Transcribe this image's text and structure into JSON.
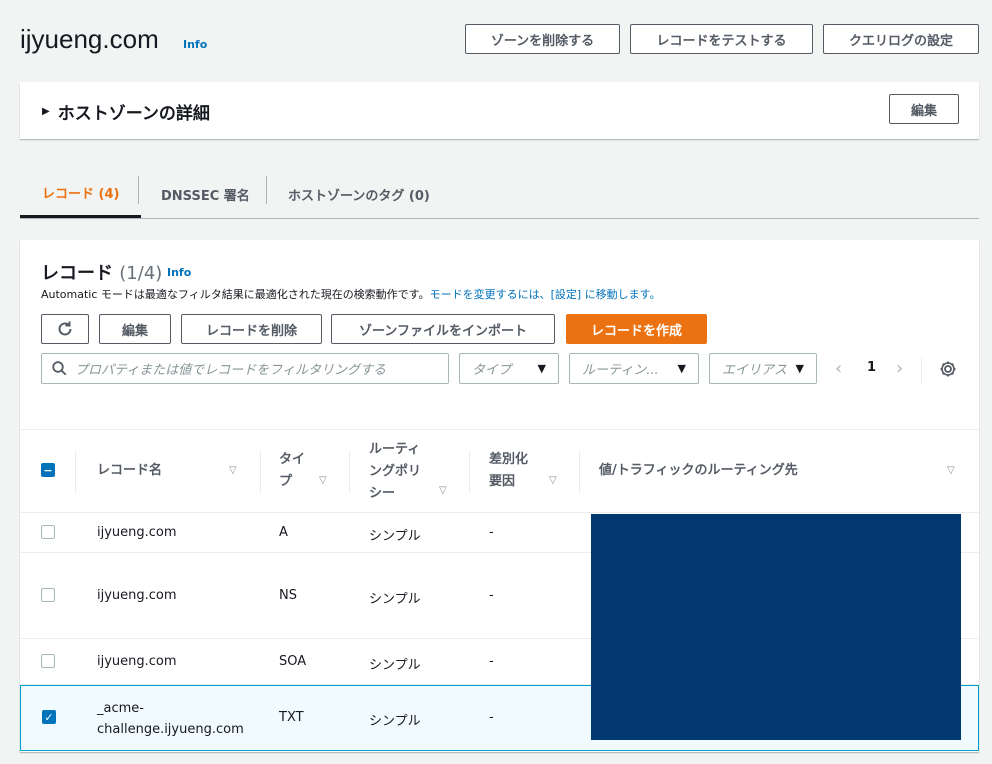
{
  "header": {
    "title": "ijyueng.com",
    "info": "Info",
    "buttons": {
      "delete_zone": "ゾーンを削除する",
      "test_record": "レコードをテストする",
      "query_log": "クエリログの設定"
    }
  },
  "details": {
    "title": "ホストゾーンの詳細",
    "edit": "編集"
  },
  "tabs": [
    {
      "label": "レコード (4)",
      "active": true
    },
    {
      "label": "DNSSEC 署名",
      "active": false
    },
    {
      "label": "ホストゾーンのタグ (0)",
      "active": false
    }
  ],
  "records": {
    "title": "レコード",
    "count": "(1/4)",
    "info": "Info",
    "desc_prefix": "Automatic モードは最適なフィルタ結果に最適化された現在の検索動作です。",
    "desc_link": "モードを変更するには、[設定] に移動します。",
    "actions": {
      "edit": "編集",
      "delete": "レコードを削除",
      "import": "ゾーンファイルをインポート",
      "create": "レコードを作成"
    },
    "search_placeholder": "プロパティまたは値でレコードをフィルタリングする",
    "filters": {
      "type": "タイプ",
      "routing": "ルーティン...",
      "alias": "エイリアス"
    },
    "page": "1",
    "columns": {
      "name": "レコード名",
      "type_l1": "タイ",
      "type_l2": "プ",
      "routing_l1": "ルーティ",
      "routing_l2": "ングポリ",
      "routing_l3": "シー",
      "diff_l1": "差別化",
      "diff_l2": "要因",
      "value": "値/トラフィックのルーティング先"
    },
    "rows": [
      {
        "name": "ijyueng.com",
        "type": "A",
        "policy": "シンプル",
        "diff": "-",
        "checked": false
      },
      {
        "name": "ijyueng.com",
        "type": "NS",
        "policy": "シンプル",
        "diff": "-",
        "checked": false
      },
      {
        "name": "ijyueng.com",
        "type": "SOA",
        "policy": "シンプル",
        "diff": "-",
        "checked": false
      },
      {
        "name_l1": "_acme-",
        "name_l2": "challenge.ijyueng.com",
        "type": "TXT",
        "policy": "シンプル",
        "diff": "-",
        "checked": true
      }
    ]
  },
  "colors": {
    "accent": "#ec7211",
    "link": "#0073bb",
    "redaction": "#023870"
  }
}
